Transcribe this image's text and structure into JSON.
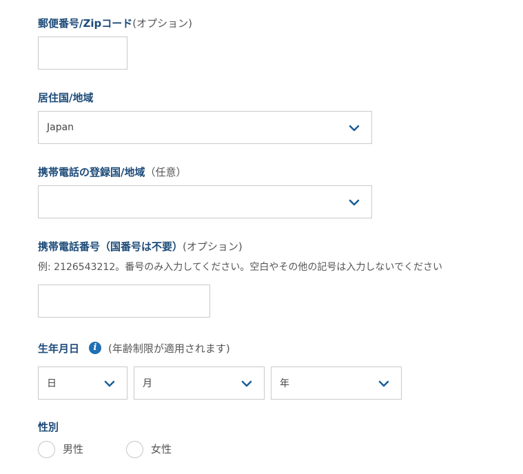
{
  "postal": {
    "label": "郵便番号/Zipコード",
    "optional": "(オプション)",
    "value": ""
  },
  "residence": {
    "label": "居住国/地域",
    "value": "Japan"
  },
  "phone_country": {
    "label": "携帯電話の登録国/地域",
    "optional": "（任意）",
    "value": ""
  },
  "phone_number": {
    "label": "携帯電話番号（国番号は不要）",
    "optional": "(オプション)",
    "hint": "例: 2126543212。番号のみ入力してください。空白やその他の記号は入力しないでください",
    "value": ""
  },
  "birthdate": {
    "label": "生年月日",
    "info_icon": "info-icon",
    "note": "(年齢制限が適用されます)",
    "day_placeholder": "日",
    "month_placeholder": "月",
    "year_placeholder": "年"
  },
  "gender": {
    "label": "性別",
    "options": [
      "男性",
      "女性"
    ]
  },
  "colors": {
    "label": "#1c4a78",
    "chevron": "#1c5e96",
    "border": "#c9c9c9",
    "info": "#1f6fb3"
  }
}
